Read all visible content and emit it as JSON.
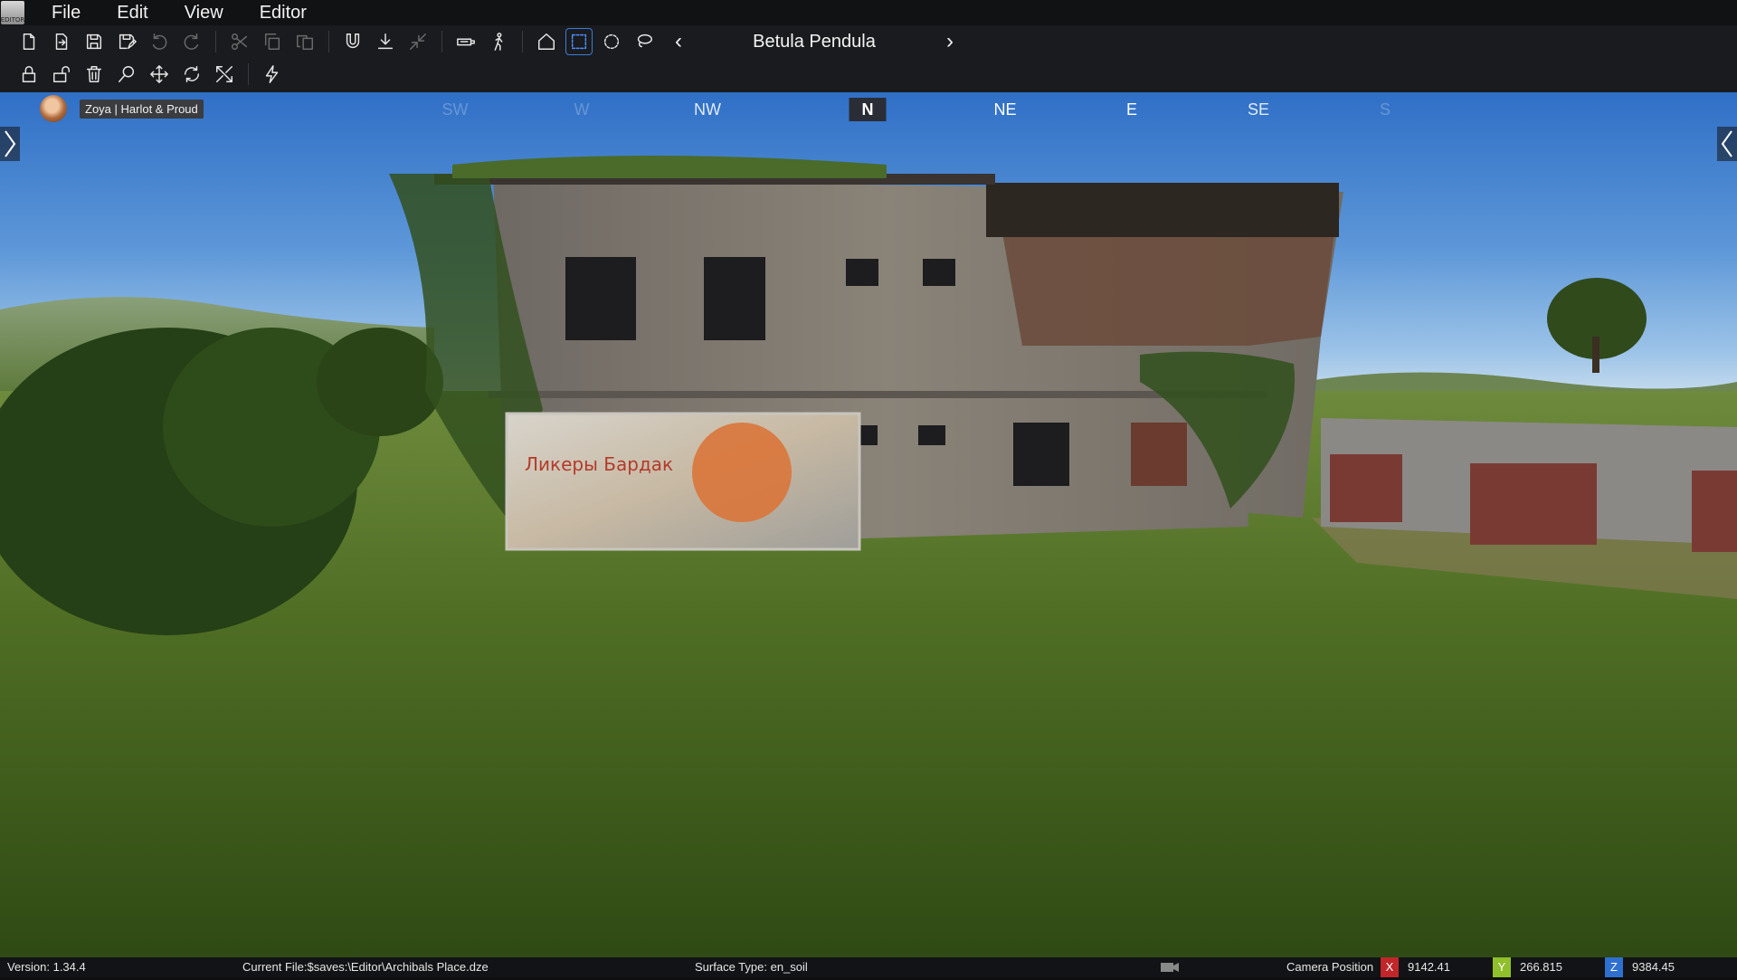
{
  "app": {
    "logo_text": "EDITOR"
  },
  "menu": {
    "items": [
      "File",
      "Edit",
      "View",
      "Editor"
    ]
  },
  "toolbar": {
    "row1": [
      {
        "icon": "new-file-icon",
        "enabled": true
      },
      {
        "icon": "open-file-icon",
        "enabled": true
      },
      {
        "icon": "save-icon",
        "enabled": true
      },
      {
        "icon": "save-as-icon",
        "enabled": true
      },
      {
        "icon": "undo-icon",
        "enabled": false
      },
      {
        "icon": "redo-icon",
        "enabled": false
      },
      {
        "icon": "cut-icon",
        "enabled": false
      },
      {
        "icon": "copy-icon",
        "enabled": false
      },
      {
        "icon": "paste-icon",
        "enabled": false
      },
      {
        "icon": "magnet-icon",
        "enabled": true
      },
      {
        "icon": "ground-snap-icon",
        "enabled": true
      },
      {
        "icon": "collapse-icon",
        "enabled": false
      },
      {
        "icon": "camera-tool-icon",
        "enabled": true
      },
      {
        "icon": "walk-icon",
        "enabled": true
      },
      {
        "icon": "home-icon",
        "enabled": true
      },
      {
        "icon": "box-select-icon",
        "enabled": true,
        "active": true
      },
      {
        "icon": "circle-select-icon",
        "enabled": true
      },
      {
        "icon": "lasso-select-icon",
        "enabled": true
      }
    ],
    "row2": [
      {
        "icon": "lock-icon",
        "enabled": true
      },
      {
        "icon": "unlock-icon",
        "enabled": true
      },
      {
        "icon": "delete-icon",
        "enabled": true
      },
      {
        "icon": "search-icon",
        "enabled": true
      },
      {
        "icon": "move-icon",
        "enabled": true
      },
      {
        "icon": "rotate-icon",
        "enabled": true
      },
      {
        "icon": "scale-icon",
        "enabled": true
      },
      {
        "icon": "lightning-icon",
        "enabled": true
      }
    ],
    "selected_object": "Betula Pendula"
  },
  "compass": {
    "ticks": [
      {
        "label": "SW",
        "state": "faint"
      },
      {
        "label": "W",
        "state": "faint"
      },
      {
        "label": "NW",
        "state": "mid"
      },
      {
        "label": "N",
        "state": "current"
      },
      {
        "label": "NE",
        "state": "bright"
      },
      {
        "label": "E",
        "state": "bright"
      },
      {
        "label": "SE",
        "state": "mid"
      },
      {
        "label": "S",
        "state": "faint"
      }
    ]
  },
  "user": {
    "name": "Zoya | Harlot & Proud"
  },
  "scene": {
    "billboard_text": "Ликеры Бардак"
  },
  "status": {
    "version": "Version:  1.34.4",
    "current_file": "Current File:$saves:\\Editor\\Archibals Place.dze",
    "surface": "Surface Type: en_soil",
    "camera_label": "Camera Position",
    "x_label": "X",
    "x": "9142.41",
    "y_label": "Y",
    "y": "266.815",
    "z_label": "Z",
    "z": "9384.45"
  }
}
